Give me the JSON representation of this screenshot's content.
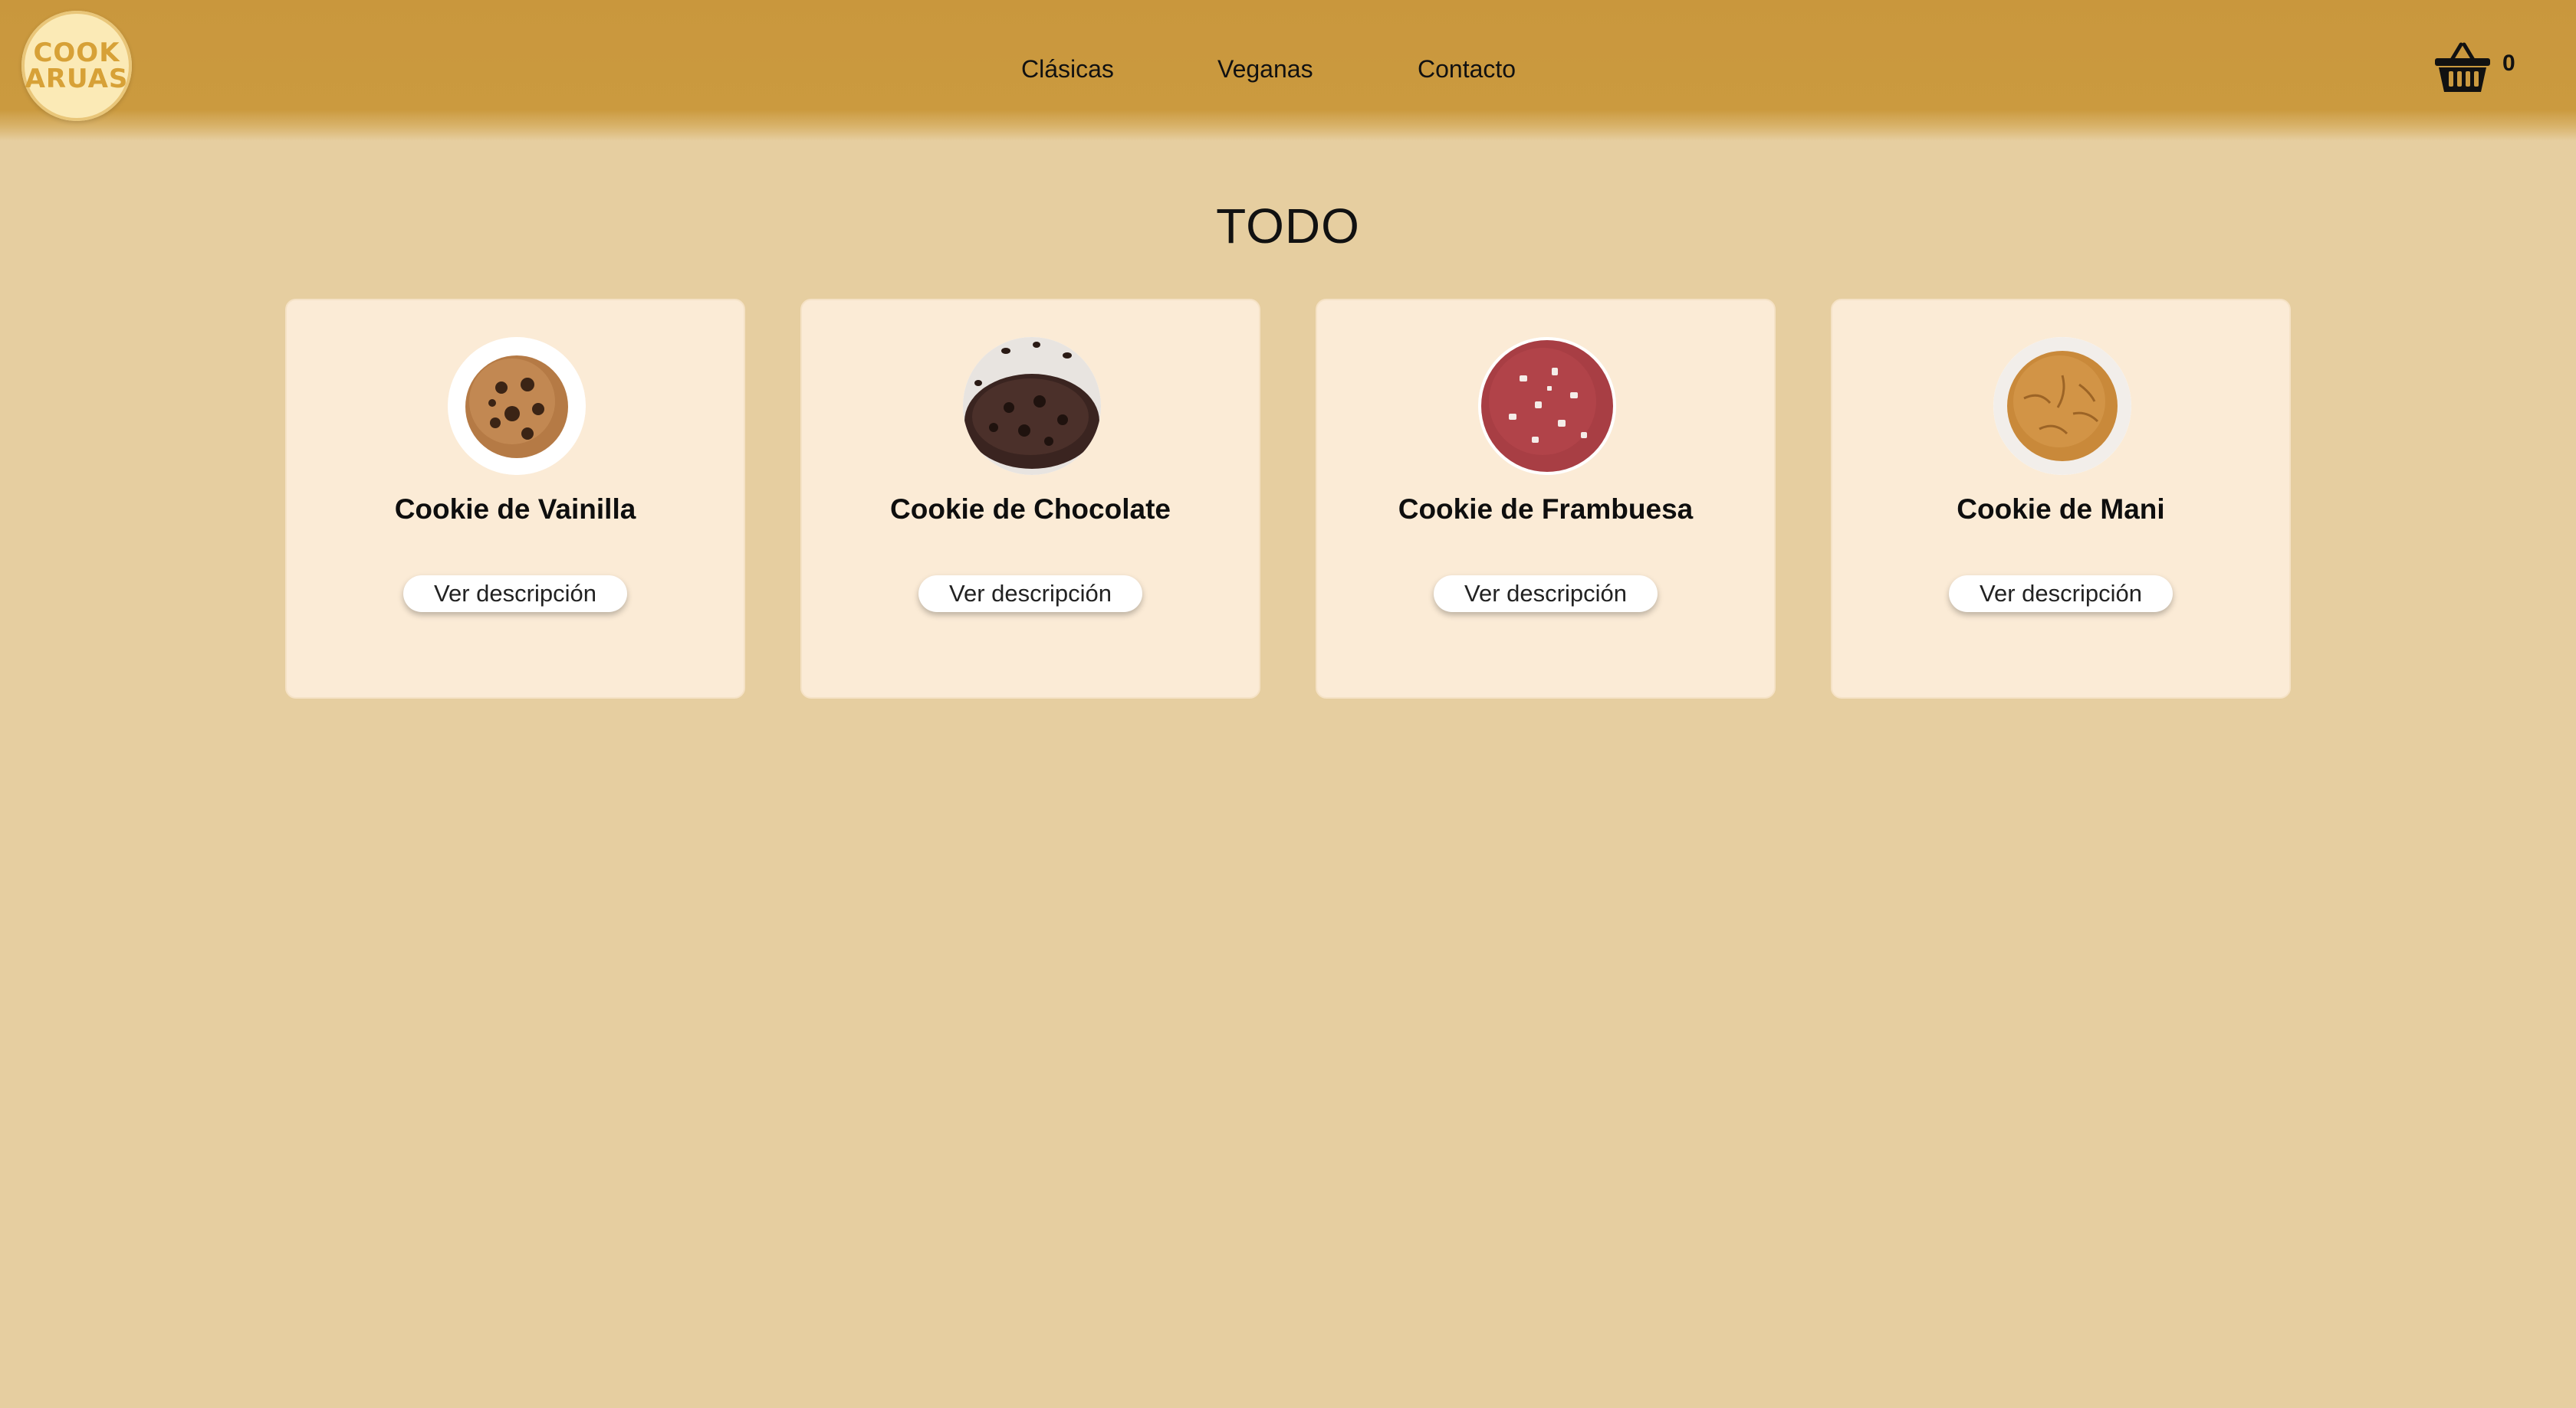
{
  "header": {
    "logo": {
      "line1": "COOK",
      "line2": "ARUAS"
    },
    "nav": [
      {
        "label": "Clásicas"
      },
      {
        "label": "Veganas"
      },
      {
        "label": "Contacto"
      }
    ],
    "cart": {
      "icon": "basket-icon",
      "count": "0"
    }
  },
  "main": {
    "title": "TODO",
    "products": [
      {
        "name": "Cookie de Vainilla",
        "button": "Ver descripción",
        "image": "vanilla-cookie"
      },
      {
        "name": "Cookie de Chocolate",
        "button": "Ver descripción",
        "image": "chocolate-cookie"
      },
      {
        "name": "Cookie de Frambuesa",
        "button": "Ver descripción",
        "image": "raspberry-cookie"
      },
      {
        "name": "Cookie de Mani",
        "button": "Ver descripción",
        "image": "peanut-cookie"
      }
    ]
  },
  "colors": {
    "header": "#cb9a3f",
    "page_background": "#e6cea0",
    "card_background": "#fbebd6",
    "logo_background": "#fbeab6",
    "logo_text": "#d7a137"
  }
}
